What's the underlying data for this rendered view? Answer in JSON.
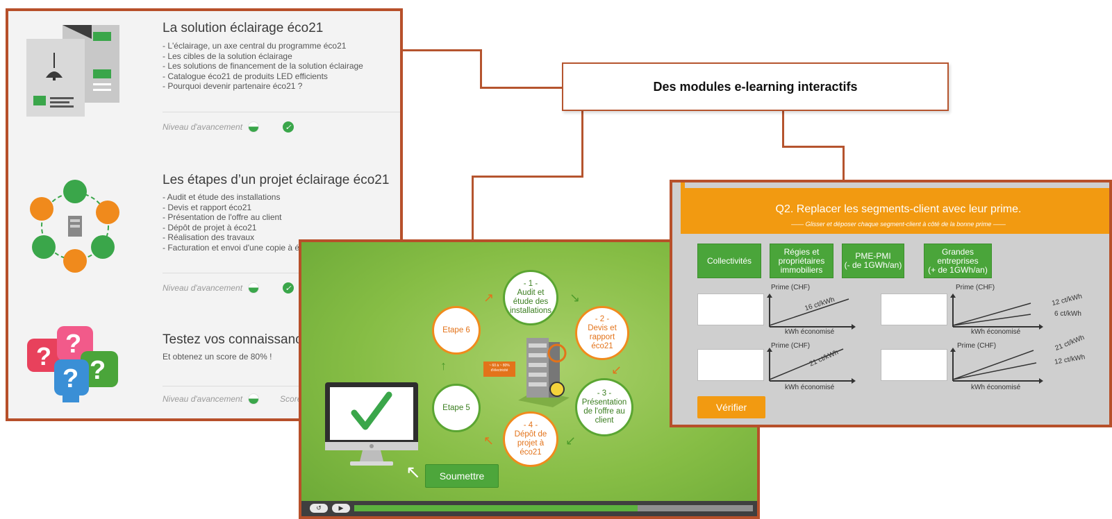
{
  "label_box": {
    "text": "Des modules e-learning interactifs"
  },
  "panel1": {
    "modules": [
      {
        "title": "La solution éclairage éco21",
        "items": [
          "- L'éclairage, un axe central du programme éco21",
          "- Les cibles de la solution éclairage",
          "- Les solutions de financement de la solution éclairage",
          "- Catalogue éco21 de produits LED efficients",
          "- Pourquoi devenir partenaire éco21 ?"
        ],
        "progress_label": "Niveau d'avancement"
      },
      {
        "title": "Les étapes d’un projet éclairage éco21",
        "items": [
          "- Audit et étude des installations",
          "- Devis et rapport éco21",
          "- Présentation de l'offre au client",
          "- Dépôt de projet à éco21",
          "- Réalisation des travaux",
          "- Facturation et envoi d'une copie à é"
        ],
        "progress_label": "Niveau d'avancement"
      },
      {
        "title": "Testez vos connaissance",
        "items": [
          "Et obtenez un score de 80% !"
        ],
        "progress_label": "Niveau d'avancement",
        "score_label": "Score"
      }
    ]
  },
  "panel2": {
    "steps": {
      "s1": "- 1 -\nAudit et\nétude des\ninstallations",
      "s2": "- 2 -\nDevis et\nrapport\néco21",
      "s3": "- 3 -\nPrésentation\nde l'offre au\nclient",
      "s4": "- 4 -\nDépôt de\nprojet à\néco21",
      "s5": "Etape 5",
      "s6": "Etape 6"
    },
    "badge": "~ 60 à ~ 80%\nd'électricité",
    "submit_label": "Soumettre",
    "progress": 0.71
  },
  "panel3": {
    "question": "Q2. Replacer les segments-client avec leur prime.",
    "instruction": "Glisser et déposer chaque segment-client à côté de la bonne prime",
    "segments": [
      "Collectivités",
      "Régies et\npropriétaires\nimmobiliers",
      "PME-PMI\n(- de 1GWh/an)",
      "Grandes\nentreprises\n(+ de 1GWh/an)"
    ],
    "y_axis": "Prime (CHF)",
    "x_axis": "kWh économisé",
    "graphs": {
      "g1": [
        "16 ct/kWh"
      ],
      "g2": [
        "12 ct/kWh",
        "6 ct/kWh"
      ],
      "g3": [
        "21 ct/kWh"
      ],
      "g4": [
        "21 ct/kWh",
        "12 ct/kWh"
      ]
    },
    "verify_label": "Vérifier"
  },
  "colors": {
    "frame": "#b7502a",
    "green": "#4aa53a",
    "orange": "#f29a11"
  }
}
